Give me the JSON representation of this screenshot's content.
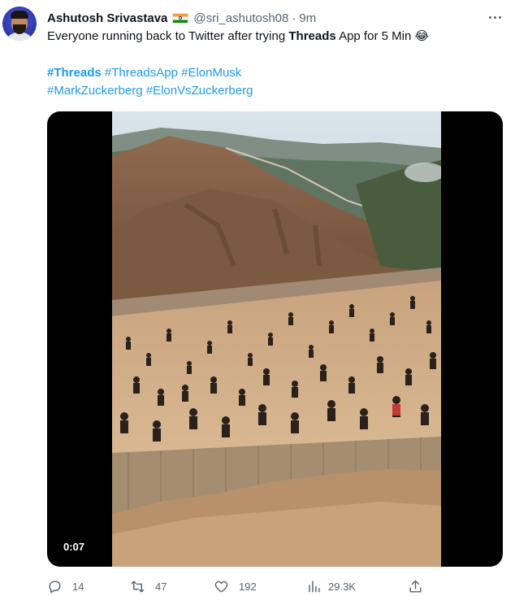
{
  "author": {
    "name": "Ashutosh Srivastava",
    "handle": "@sri_ashutosh08",
    "separator": "·",
    "time": "9m",
    "flag": "india-flag"
  },
  "tweet": {
    "text_before": "Everyone running back to Twitter after trying ",
    "text_bold": "Threads",
    "text_after": " App for 5 Min ",
    "emoji": "😂",
    "hashtags_line1": [
      {
        "label": "#Threads",
        "bold": true
      },
      {
        "label": "#ThreadsApp",
        "bold": false
      },
      {
        "label": "#ElonMusk",
        "bold": false
      }
    ],
    "hashtags_line2": [
      {
        "label": "#MarkZuckerberg",
        "bold": false
      },
      {
        "label": "#ElonVsZuckerberg",
        "bold": false
      }
    ]
  },
  "media": {
    "duration": "0:07",
    "scene": "video-frame-crowd-running-across-field"
  },
  "actions": {
    "replies": "14",
    "retweets": "47",
    "likes": "192",
    "views": "29.3K"
  },
  "colors": {
    "link": "#1d9bf0",
    "secondary_text": "#536471",
    "primary_text": "#0f1419"
  }
}
